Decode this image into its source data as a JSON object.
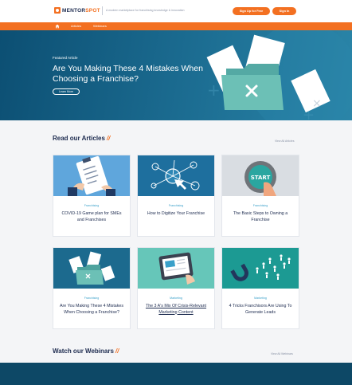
{
  "header": {
    "logo_brand": "MENTOR",
    "logo_brand_accent": "SPOT",
    "tagline": "A modern marketplace for franchising knowledge & innovation",
    "signup_label": "Sign Up for Free",
    "signin_label": "Sign In"
  },
  "nav": {
    "items": [
      {
        "label": "Articles"
      },
      {
        "label": "Webinars"
      }
    ]
  },
  "hero": {
    "kicker": "Featured Article",
    "title": "Are You Making These 4 Mistakes When Choosing a Franchise?",
    "button_label": "Learn More"
  },
  "articles_section": {
    "title": "Read our Articles",
    "slash": "//",
    "view_all": "View All Articles"
  },
  "articles": [
    {
      "category": "Franchising",
      "title": "COVID-19 Game plan for SMEs and Franchises"
    },
    {
      "category": "Franchising",
      "title": "How to Digitize Your Franchise"
    },
    {
      "category": "Franchising",
      "title": "The Basic Steps to Owning a Franchise"
    },
    {
      "category": "Franchising",
      "title": "Are You Making These 4 Mistakes When Choosing a Franchise?"
    },
    {
      "category": "Marketing",
      "title": "The 3 A's Mix Of Crisis-Relevant Marketing Content"
    },
    {
      "category": "Marketing",
      "title": "4 Tricks Franchisors Are Using To Generate Leads"
    }
  ],
  "webinars_section": {
    "title": "Watch our Webinars",
    "slash": "//",
    "view_all": "View All Webinars"
  },
  "colors": {
    "accent": "#f37021",
    "navy": "#1d2b4f",
    "hero_blue": "#0c4f73",
    "teal": "#3aa0c9"
  }
}
